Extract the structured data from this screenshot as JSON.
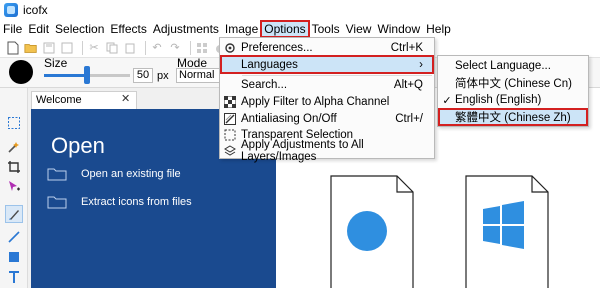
{
  "app": {
    "title": "icofx"
  },
  "menubar": [
    "File",
    "Edit",
    "Selection",
    "Effects",
    "Adjustments",
    "Image",
    "Options",
    "Tools",
    "View",
    "Window",
    "Help"
  ],
  "properties": {
    "size_label": "Size",
    "size_value": "50",
    "size_unit": "px",
    "size_fraction": 0.5,
    "mode_label": "Mode",
    "mode_value": "Normal"
  },
  "options_menu": {
    "preferences": {
      "label": "Preferences...",
      "shortcut": "Ctrl+K"
    },
    "languages": {
      "label": "Languages",
      "arrow": "›"
    },
    "search": {
      "label": "Search...",
      "shortcut": "Alt+Q"
    },
    "apply_filter": {
      "label": "Apply Filter to Alpha Channel"
    },
    "antialiasing": {
      "label": "Antialiasing On/Off",
      "shortcut": "Ctrl+/"
    },
    "transparent": {
      "label": "Transparent Selection"
    },
    "apply_adjustments": {
      "label": "Apply Adjustments to All Layers/Images"
    }
  },
  "languages_submenu": [
    {
      "label": "Select Language...",
      "check": ""
    },
    {
      "label": "简体中文 (Chinese Cn)",
      "check": ""
    },
    {
      "label": "English (English)",
      "check": "✓"
    },
    {
      "label": "繁體中文 (Chinese Zh)",
      "check": ""
    }
  ],
  "welcome": {
    "tab_label": "Welcome",
    "tab_close": "✕",
    "heading": "Open",
    "open_existing": "Open an existing file",
    "extract_icons": "Extract icons from files"
  },
  "colors": {
    "accent": "#2a78d4",
    "panel": "#1a4a8f",
    "highlight": "#cce4f7",
    "callout": "#d32020"
  }
}
